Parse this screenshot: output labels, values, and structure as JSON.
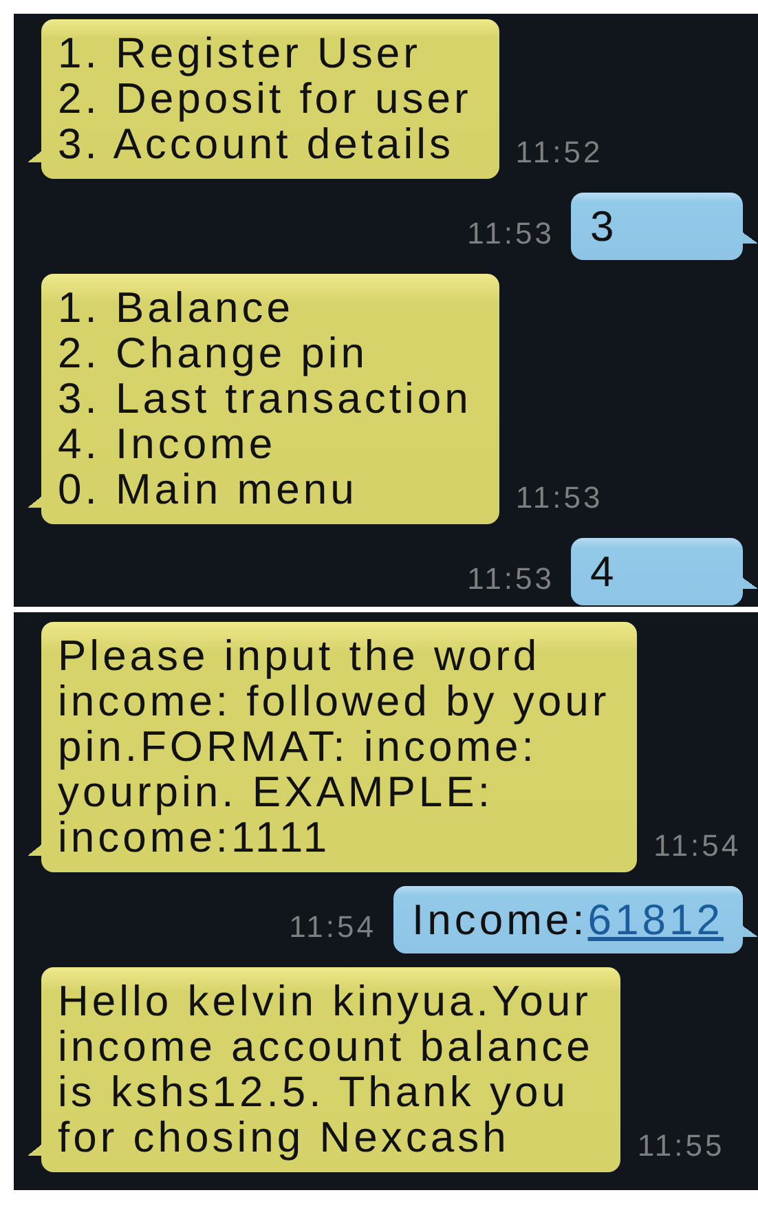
{
  "panels": [
    {
      "messages": [
        {
          "kind": "received",
          "lines": [
            "1. Register User",
            "2. Deposit for user",
            "3. Account details"
          ],
          "time": "11:52"
        },
        {
          "kind": "sent",
          "lines": [
            "3"
          ],
          "time": "11:53"
        },
        {
          "kind": "received",
          "lines": [
            "1. Balance",
            "2. Change pin",
            "3. Last transaction",
            "4. Income",
            "0. Main menu"
          ],
          "time": "11:53"
        },
        {
          "kind": "sent",
          "lines": [
            "4"
          ],
          "time": "11:53"
        }
      ]
    },
    {
      "messages": [
        {
          "kind": "received",
          "lines": [
            "Please input the word",
            "income: followed by your",
            "pin.FORMAT: income:",
            "yourpin. EXAMPLE:",
            "income:1111"
          ],
          "time": "11:54"
        },
        {
          "kind": "sent",
          "lines": [
            "Income:"
          ],
          "link": "61812",
          "time": "11:54"
        },
        {
          "kind": "received",
          "lines": [
            "Hello kelvin kinyua.Your",
            "income account balance",
            "is kshs12.5. Thank you",
            "for chosing Nexcash"
          ],
          "time": "11:55"
        }
      ]
    }
  ]
}
